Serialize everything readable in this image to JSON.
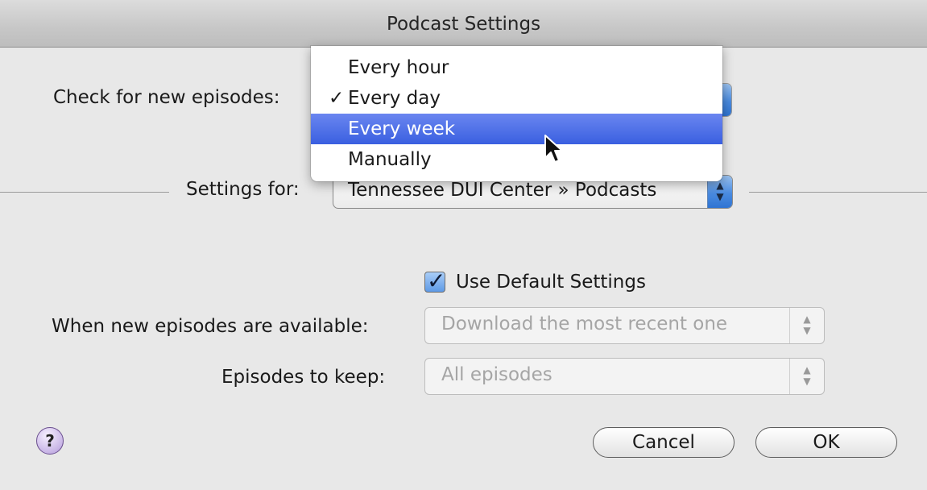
{
  "window": {
    "title": "Podcast Settings"
  },
  "check": {
    "label": "Check for new episodes:",
    "menu": {
      "items": [
        {
          "label": "Every hour",
          "checked": false,
          "highlighted": false
        },
        {
          "label": "Every day",
          "checked": true,
          "highlighted": false
        },
        {
          "label": "Every week",
          "checked": false,
          "highlighted": true
        },
        {
          "label": "Manually",
          "checked": false,
          "highlighted": false
        }
      ],
      "check_mark": "✓"
    }
  },
  "settings_for": {
    "label": "Settings for:",
    "value": "Tennessee DUI Center » Podcasts"
  },
  "use_default": {
    "label": "Use Default Settings",
    "checked": true
  },
  "when_new": {
    "label": "When new episodes are available:",
    "value": "Download the most recent one"
  },
  "keep": {
    "label": "Episodes to keep:",
    "value": "All episodes"
  },
  "buttons": {
    "help": "?",
    "cancel": "Cancel",
    "ok": "OK"
  },
  "colors": {
    "accent_blue": "#4a8be0",
    "menu_highlight": "#3a5fe0",
    "help_purple": "#c8b5e6"
  },
  "icons": {
    "stepper_up": "▲",
    "stepper_down": "▼"
  }
}
